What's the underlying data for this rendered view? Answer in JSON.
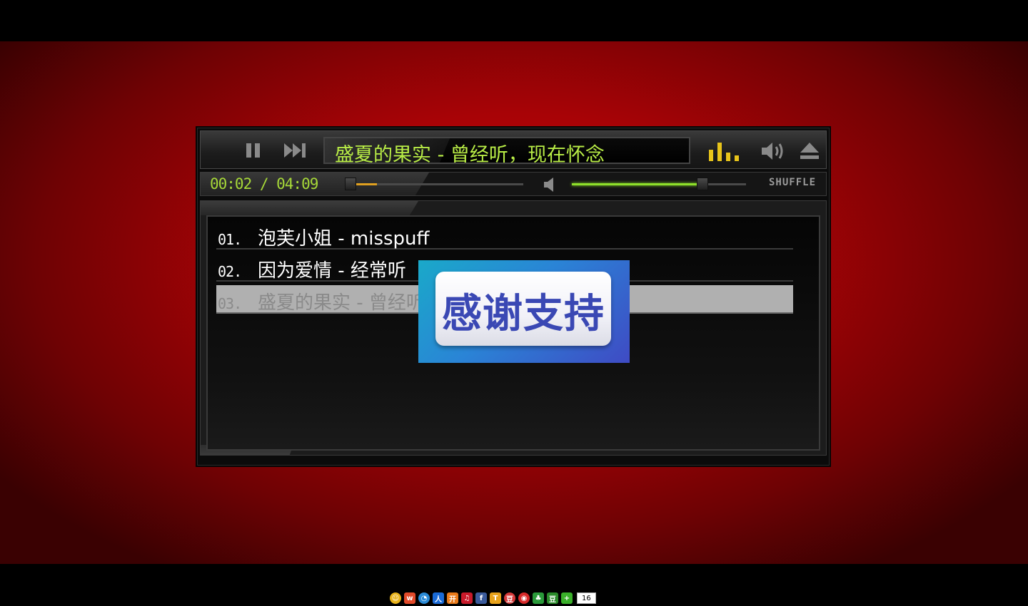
{
  "player": {
    "now_playing": "盛夏的果实 - 曾经听，现在怀念",
    "time": "00:02 / 04:09",
    "progress": 0.18,
    "volume": 0.75,
    "shuffle_label": "SHUFFLE"
  },
  "colors": {
    "accent": "#b8ec46",
    "stage": "#b30306",
    "progress_fill": "#e0a020",
    "volume_fill": "#8ee02a",
    "overlay_text": "#3a48b4"
  },
  "icons": {
    "pause": "pause-icon",
    "next": "next-icon",
    "equalizer": "equalizer-icon",
    "volume": "volume-icon",
    "eject": "eject-icon",
    "mute": "mute-icon"
  },
  "playlist": [
    {
      "num": "01.",
      "title": "泡芙小姐 - misspuff"
    },
    {
      "num": "02.",
      "title": "因为爱情 - 经常听"
    },
    {
      "num": "03.",
      "title": "盛夏的果实 - 曾经听，现在怀念"
    }
  ],
  "overlay": {
    "text": "感谢支持"
  },
  "share": {
    "count": "16"
  }
}
